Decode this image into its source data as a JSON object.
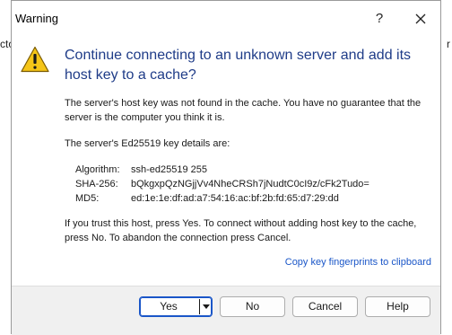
{
  "background": {
    "left_text": "cto",
    "right_text": "r"
  },
  "dialog": {
    "title": "Warning",
    "help_button": "?",
    "heading": "Continue connecting to an unknown server and add its host key to a cache?",
    "para1": "The server's host key was not found in the cache. You have no guarantee that the server is the computer you think it is.",
    "para2": "The server's Ed25519 key details are:",
    "key_details": [
      {
        "label": "Algorithm:",
        "value": "ssh-ed25519 255"
      },
      {
        "label": "SHA-256:",
        "value": "bQkgxpQzNGjjVv4NheCRSh7jNudtC0cI9z/cFk2Tudo="
      },
      {
        "label": "MD5:",
        "value": "ed:1e:1e:df:ad:a7:54:16:ac:bf:2b:fd:65:d7:29:dd"
      }
    ],
    "para3": "If you trust this host, press Yes. To connect without adding host key to the cache, press No. To abandon the connection press Cancel.",
    "copy_link": "Copy key fingerprints to clipboard"
  },
  "buttons": {
    "yes": "Yes",
    "no": "No",
    "cancel": "Cancel",
    "help": "Help"
  },
  "colors": {
    "heading": "#1f3c88",
    "link": "#1a56c8",
    "warning_fill": "#f5c518",
    "footer_bg": "#f0f0f0",
    "default_button_border": "#1a56c8"
  },
  "icons": {
    "warning": "warning-triangle-icon",
    "close": "close-icon",
    "dropdown": "caret-down-icon"
  }
}
